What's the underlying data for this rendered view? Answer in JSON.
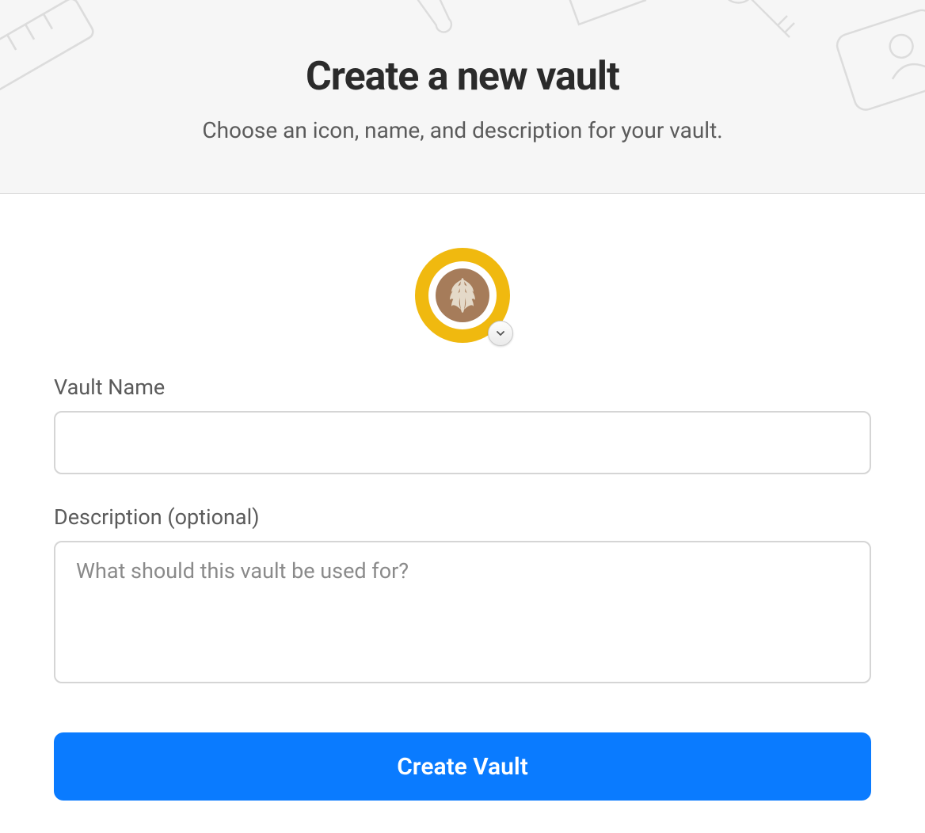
{
  "header": {
    "title": "Create a new vault",
    "subtitle": "Choose an icon, name, and description for your vault."
  },
  "icon": {
    "selected": "coffee-latte",
    "accent_color": "#f0b90f"
  },
  "form": {
    "name": {
      "label": "Vault Name",
      "value": ""
    },
    "description": {
      "label": "Description (optional)",
      "placeholder": "What should this vault be used for?",
      "value": ""
    }
  },
  "actions": {
    "create": "Create Vault"
  }
}
